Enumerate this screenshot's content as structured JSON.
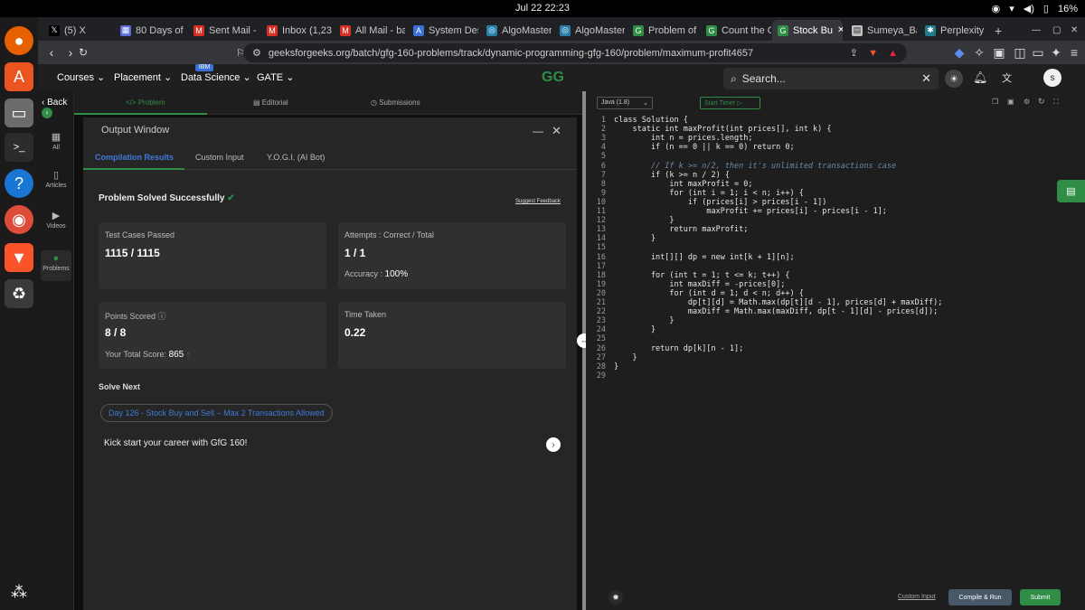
{
  "system": {
    "clock": "Jul 22  22:23",
    "battery": "16%"
  },
  "tabs": [
    {
      "label": "(5) X",
      "icon": "x-icon",
      "color": "#000000"
    },
    {
      "label": "80 Days of",
      "icon": "calendar-icon",
      "color": "#5b6bd8"
    },
    {
      "label": "Sent Mail -",
      "icon": "gmail-icon",
      "color": "#d93025"
    },
    {
      "label": "Inbox (1,23",
      "icon": "gmail-icon",
      "color": "#d93025"
    },
    {
      "label": "All Mail - ba",
      "icon": "gmail-icon",
      "color": "#d93025"
    },
    {
      "label": "System Des",
      "icon": "a-icon",
      "color": "#3a6fd8"
    },
    {
      "label": "AlgoMaster",
      "icon": "algomaster-icon",
      "color": "#2a7fa8"
    },
    {
      "label": "AlgoMaster",
      "icon": "algomaster-icon",
      "color": "#2a7fa8"
    },
    {
      "label": "Problem of",
      "icon": "gfg-icon",
      "color": "#2f8d46"
    },
    {
      "label": "Count the C",
      "icon": "gfg-icon",
      "color": "#2f8d46"
    },
    {
      "label": "Stock Bu",
      "icon": "gfg-icon",
      "color": "#2f8d46"
    },
    {
      "label": "Sumeya_Ba",
      "icon": "doc-icon",
      "color": "#c0c0c0"
    },
    {
      "label": "Perplexity",
      "icon": "perplexity-icon",
      "color": "#1f7a8c"
    }
  ],
  "url": "geeksforgeeks.org/batch/gfg-160-problems/track/dynamic-programming-gfg-160/problem/maximum-profit4657",
  "header": {
    "menus": [
      "Courses",
      "Placement",
      "Data Science",
      "GATE"
    ],
    "ibm_badge": "IBM",
    "logo": "GG",
    "search_placeholder": "Search...",
    "avatar": "s"
  },
  "leftnav": {
    "back": "Back",
    "items": [
      "All",
      "Articles",
      "Videos",
      "Problems"
    ]
  },
  "problem_tabs": [
    "Problem",
    "Editorial",
    "Submissions"
  ],
  "output": {
    "title": "Output Window",
    "tabs": [
      "Compilation Results",
      "Custom Input",
      "Y.O.G.I. (AI Bot)"
    ],
    "status": "Problem Solved Successfully",
    "suggest": "Suggest Feedback",
    "cards": {
      "tests_label": "Test Cases Passed",
      "tests_value": "1115 / 1115",
      "attempts_label": "Attempts : Correct / Total",
      "attempts_value": "1 / 1",
      "accuracy_label": "Accuracy :",
      "accuracy_value": "100%",
      "points_label": "Points Scored",
      "points_value": "8 / 8",
      "total_label": "Your Total Score:",
      "total_value": "865",
      "time_label": "Time Taken",
      "time_value": "0.22"
    },
    "solve_next": "Solve Next",
    "next_problem": "Day 126 - Stock Buy and Sell – Max 2 Transactions Allowed",
    "kickstart": "Kick start your career with GfG 160!"
  },
  "editor": {
    "language": "Java (1.8)",
    "timer": "Start Timer",
    "code": [
      "class Solution {",
      "    static int maxProfit(int prices[], int k) {",
      "        int n = prices.length;",
      "        if (n == 0 || k == 0) return 0;",
      "",
      "        // If k >= n/2, then it's unlimited transactions case",
      "        if (k >= n / 2) {",
      "            int maxProfit = 0;",
      "            for (int i = 1; i < n; i++) {",
      "                if (prices[i] > prices[i - 1])",
      "                    maxProfit += prices[i] - prices[i - 1];",
      "            }",
      "            return maxProfit;",
      "        }",
      "",
      "        int[][] dp = new int[k + 1][n];",
      "",
      "        for (int t = 1; t <= k; t++) {",
      "            int maxDiff = -prices[0];",
      "            for (int d = 1; d < n; d++) {",
      "                dp[t][d] = Math.max(dp[t][d - 1], prices[d] + maxDiff);",
      "                maxDiff = Math.max(maxDiff, dp[t - 1][d] - prices[d]);",
      "            }",
      "        }",
      "",
      "        return dp[k][n - 1];",
      "    }",
      "}",
      ""
    ],
    "custom_input": "Custom Input",
    "compile": "Compile & Run",
    "submit": "Submit"
  },
  "colors": {
    "accent": "#2f8d46",
    "link": "#3f7ad8"
  }
}
